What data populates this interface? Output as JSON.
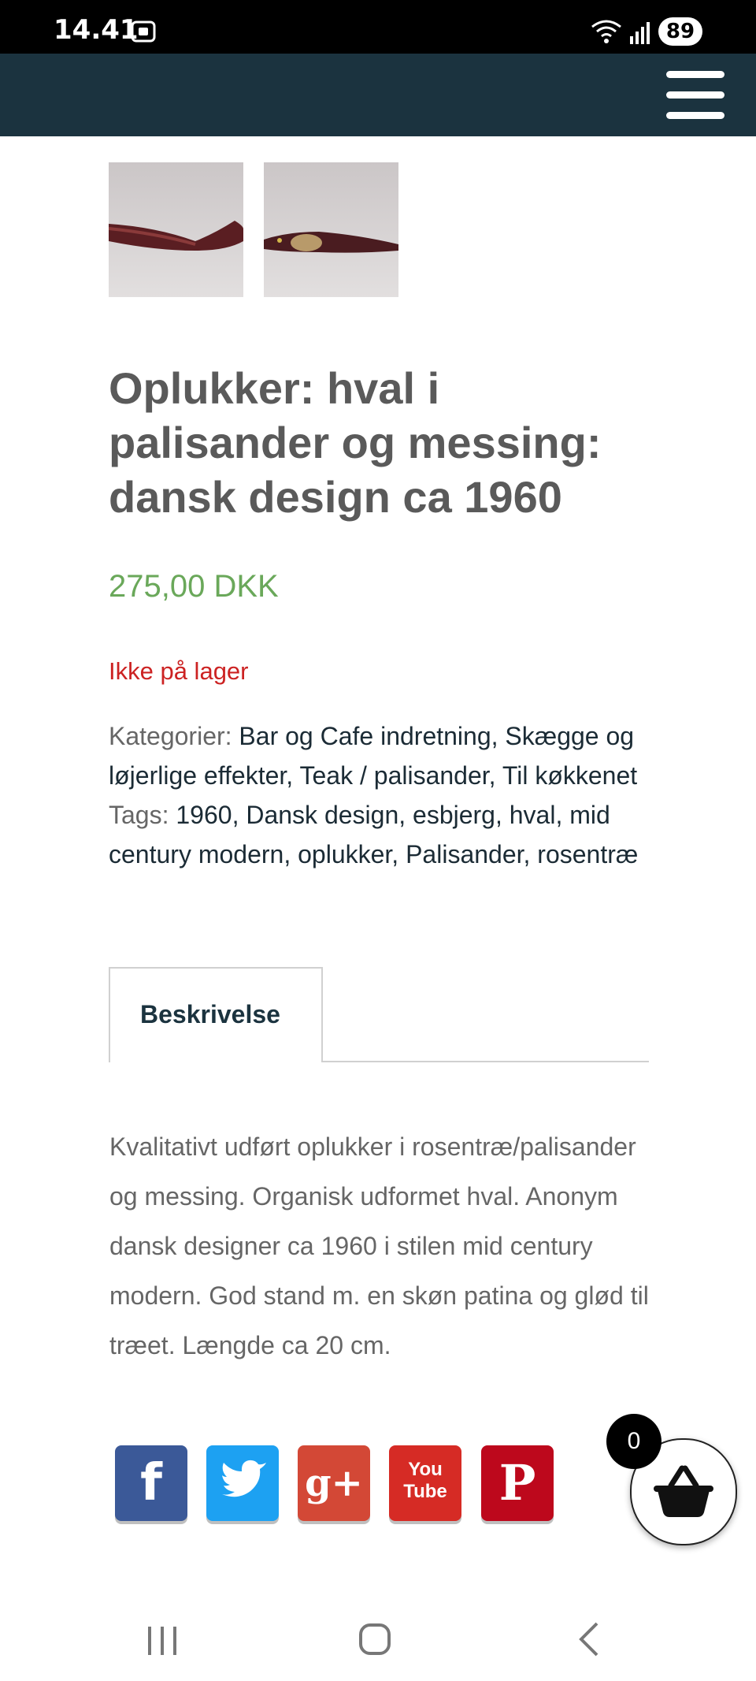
{
  "status_bar": {
    "time": "14.41",
    "battery": "89",
    "icons": [
      "screenshot-icon",
      "wifi-icon",
      "signal-icon",
      "battery-icon"
    ]
  },
  "header": {
    "background_color": "#1b333f",
    "menu_icon": "hamburger-menu-icon"
  },
  "product": {
    "title": "Oplukker: hval i palisander og messing: dansk design ca 1960",
    "price": "275,00 DKK",
    "stock_status": "Ikke på lager",
    "categories_label": "Kategorier:",
    "categories": [
      "Bar og Cafe indretning",
      "Skægge og løjerlige effekter",
      "Teak / palisander",
      "Til køkkenet"
    ],
    "tags_label": "Tags:",
    "tags": [
      "1960",
      "Dansk design",
      "esbjerg",
      "hval",
      "mid century modern",
      "oplukker",
      "Palisander",
      "rosentræ"
    ],
    "tab_label": "Beskrivelse",
    "description": "Kvalitativt udført oplukker i rosentræ/palisander og messing. Organisk udformet hval. Anonym dansk designer ca 1960 i stilen mid century modern. God stand m. en skøn patina og glød til træet. Længde ca 20 cm."
  },
  "gallery": {
    "thumbnails": [
      "product-thumbnail-1",
      "product-thumbnail-2"
    ]
  },
  "social": {
    "facebook": "f",
    "twitter": "twitter-bird-icon",
    "google_plus": "g+",
    "youtube_top": "You",
    "youtube_bottom": "Tube",
    "pinterest": "P"
  },
  "cart": {
    "count": "0",
    "icon": "basket-icon"
  },
  "nav_bar": {
    "icons": [
      "recent-apps-icon",
      "home-icon",
      "back-icon"
    ]
  },
  "colors": {
    "price": "#6aa85a",
    "stock": "#cc2222",
    "title": "#5a5a5a",
    "link": "#1b2b35"
  }
}
